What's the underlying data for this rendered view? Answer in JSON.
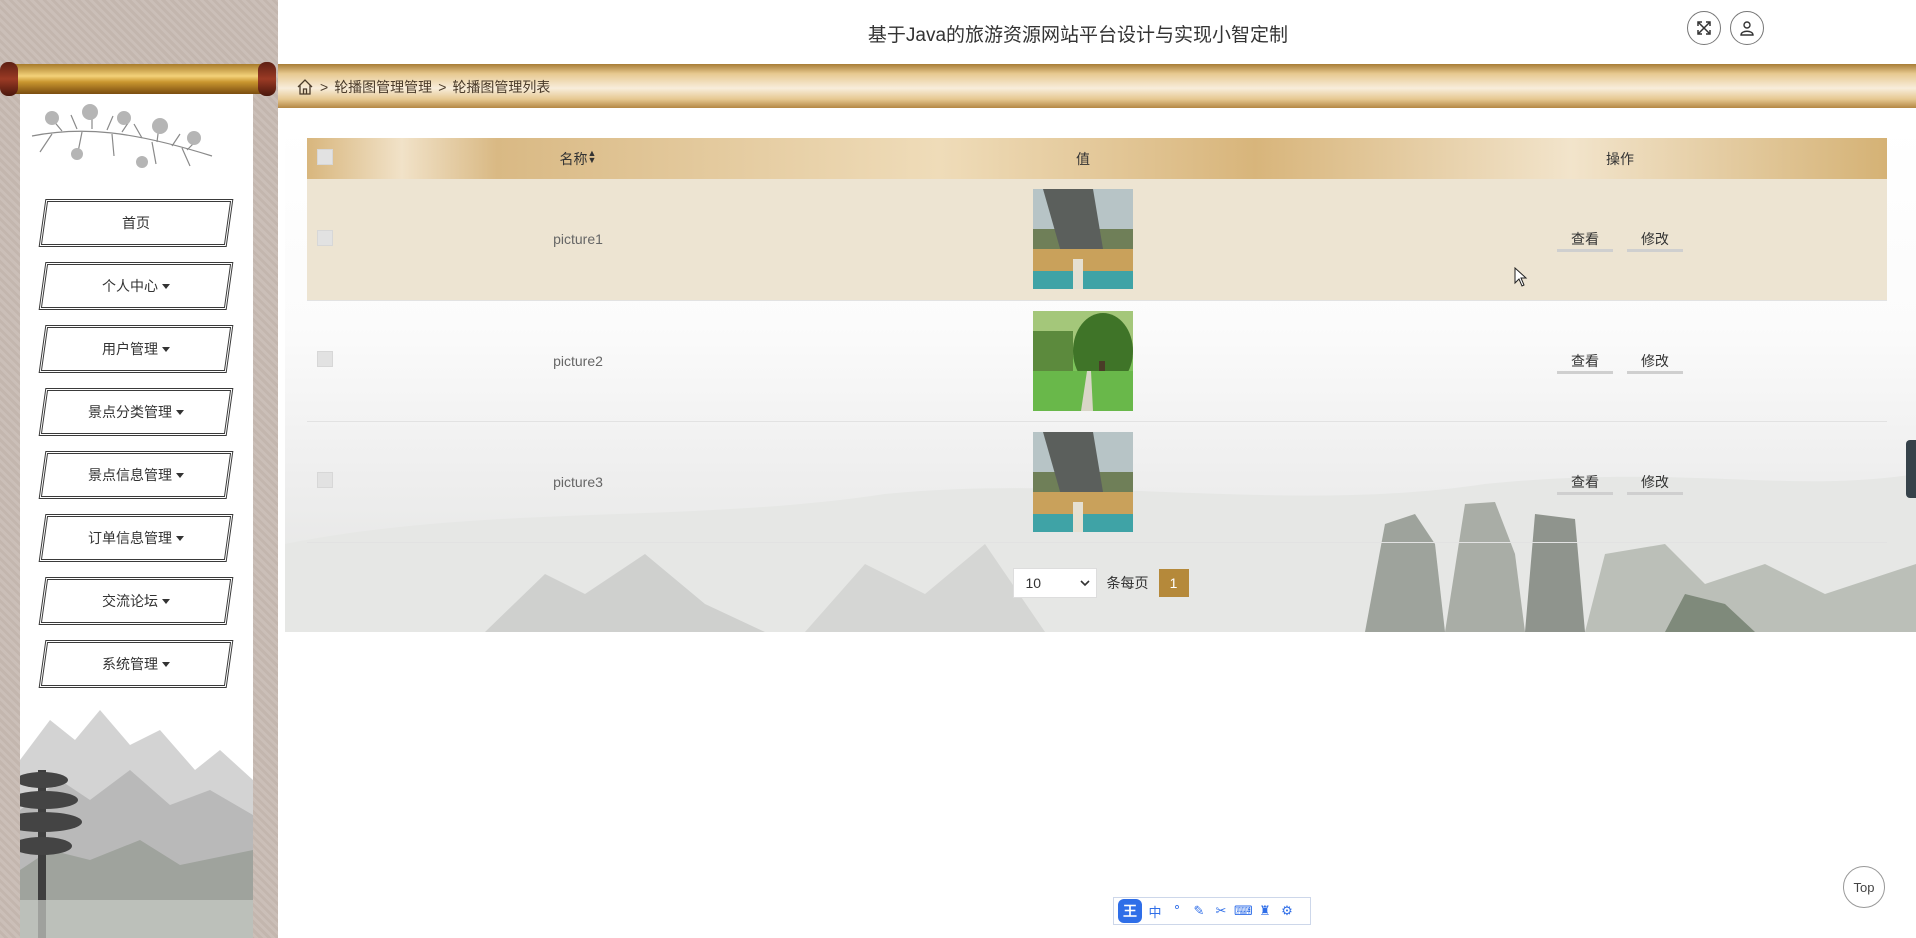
{
  "app": {
    "title": "基于Java的旅游资源网站平台设计与实现小智定制"
  },
  "header": {
    "icons": [
      "fullscreen-icon",
      "user-icon"
    ]
  },
  "breadcrumb": {
    "separator": ">",
    "items": [
      "轮播图管理管理",
      "轮播图管理列表"
    ]
  },
  "sidebar": {
    "items": [
      {
        "label": "首页",
        "has_caret": false
      },
      {
        "label": "个人中心",
        "has_caret": true
      },
      {
        "label": "用户管理",
        "has_caret": true
      },
      {
        "label": "景点分类管理",
        "has_caret": true
      },
      {
        "label": "景点信息管理",
        "has_caret": true
      },
      {
        "label": "订单信息管理",
        "has_caret": true
      },
      {
        "label": "交流论坛",
        "has_caret": true
      },
      {
        "label": "系统管理",
        "has_caret": true
      }
    ]
  },
  "table": {
    "columns": {
      "name": "名称",
      "value": "值",
      "actions": "操作"
    },
    "rows": [
      {
        "name": "picture1",
        "image": "cliff-village-thumbnail",
        "view_label": "查看",
        "edit_label": "修改",
        "highlighted": true
      },
      {
        "name": "picture2",
        "image": "tree-lawn-thumbnail",
        "view_label": "查看",
        "edit_label": "修改",
        "highlighted": false
      },
      {
        "name": "picture3",
        "image": "cliff-village-thumbnail",
        "view_label": "查看",
        "edit_label": "修改",
        "highlighted": false
      }
    ]
  },
  "pagination": {
    "page_size": "10",
    "per_page_label": "条每页",
    "current_page": "1"
  },
  "back_to_top": {
    "label": "Top"
  },
  "ime": {
    "mode_label": "中"
  },
  "colors": {
    "accent_gold": "#b5893a",
    "header_gold": "#d8b67d"
  }
}
